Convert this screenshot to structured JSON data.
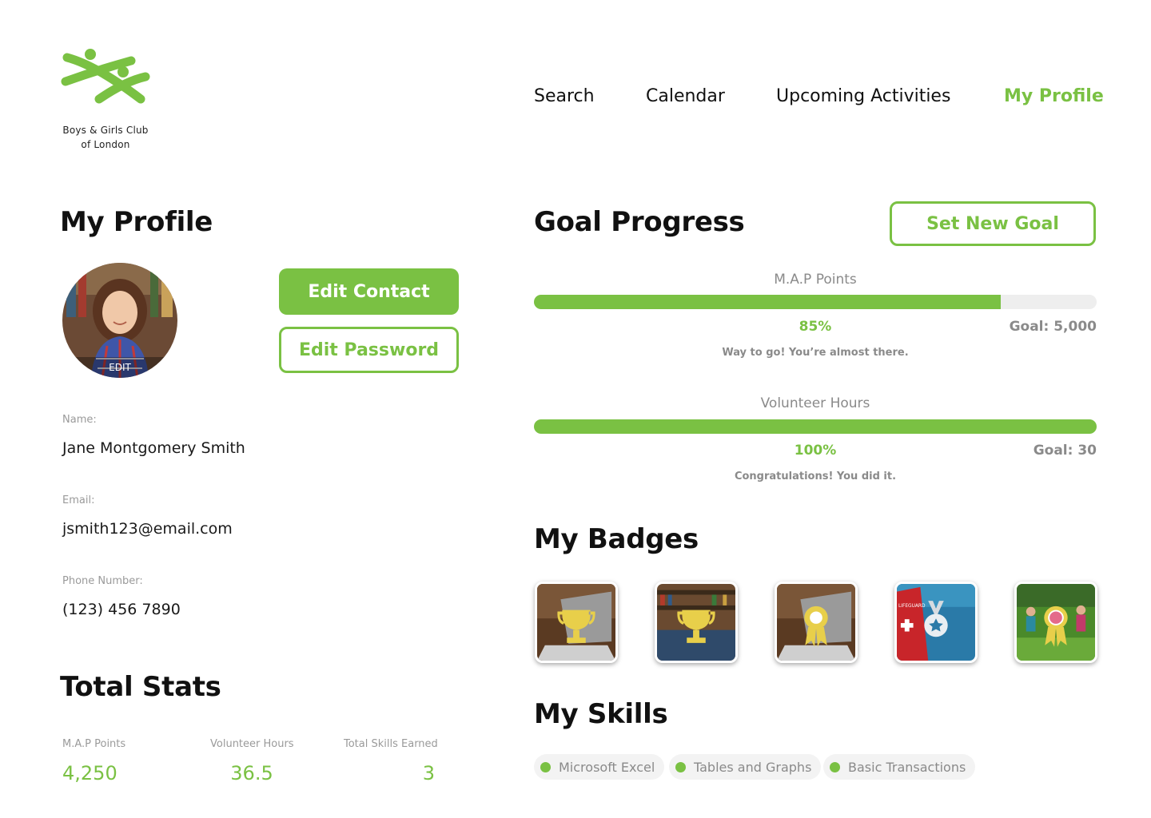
{
  "org": {
    "name_line1": "Boys & Girls Club",
    "name_line2": "of London"
  },
  "nav": {
    "items": [
      {
        "label": "Search"
      },
      {
        "label": "Calendar"
      },
      {
        "label": "Upcoming Activities"
      },
      {
        "label": "My Profile",
        "active": true
      }
    ]
  },
  "profile": {
    "title": "My Profile",
    "avatar_edit_label": "EDIT",
    "edit_contact_label": "Edit Contact",
    "edit_password_label": "Edit Password",
    "fields": [
      {
        "label": "Name:",
        "value": "Jane Montgomery Smith"
      },
      {
        "label": "Email:",
        "value": "jsmith123@email.com"
      },
      {
        "label": "Phone Number:",
        "value": "(123) 456 7890"
      }
    ]
  },
  "stats": {
    "title": "Total Stats",
    "items": [
      {
        "label": "M.A.P Points",
        "value": "4,250"
      },
      {
        "label": "Volunteer Hours",
        "value": "36.5"
      },
      {
        "label": "Total Skills Earned",
        "value": "3"
      }
    ]
  },
  "goals": {
    "title": "Goal Progress",
    "set_goal_label": "Set New Goal",
    "items": [
      {
        "title": "M.A.P Points",
        "percent_label": "85%",
        "progress": 0.83,
        "goal_label": "Goal: 5,000",
        "message": "Way to go! You’re almost there."
      },
      {
        "title": "Volunteer Hours",
        "percent_label": "100%",
        "progress": 1.0,
        "goal_label": "Goal: 30",
        "message": "Congratulations! You did it."
      }
    ]
  },
  "badges": {
    "title": "My Badges",
    "items": [
      {
        "icon": "trophy-icon",
        "scene": "laptop"
      },
      {
        "icon": "trophy-icon",
        "scene": "library"
      },
      {
        "icon": "ribbon-icon",
        "scene": "laptop"
      },
      {
        "icon": "medal-icon",
        "scene": "lifeguard",
        "photo_text": "LIFEGUARD"
      },
      {
        "icon": "ribbon-icon",
        "scene": "field"
      }
    ]
  },
  "skills": {
    "title": "My Skills",
    "items": [
      {
        "label": "Microsoft Excel"
      },
      {
        "label": "Tables and Graphs"
      },
      {
        "label": "Basic Transactions"
      }
    ]
  },
  "colors": {
    "accent": "#7ac143",
    "gold": "#e8cf4a",
    "muted": "#8a8a8a"
  }
}
